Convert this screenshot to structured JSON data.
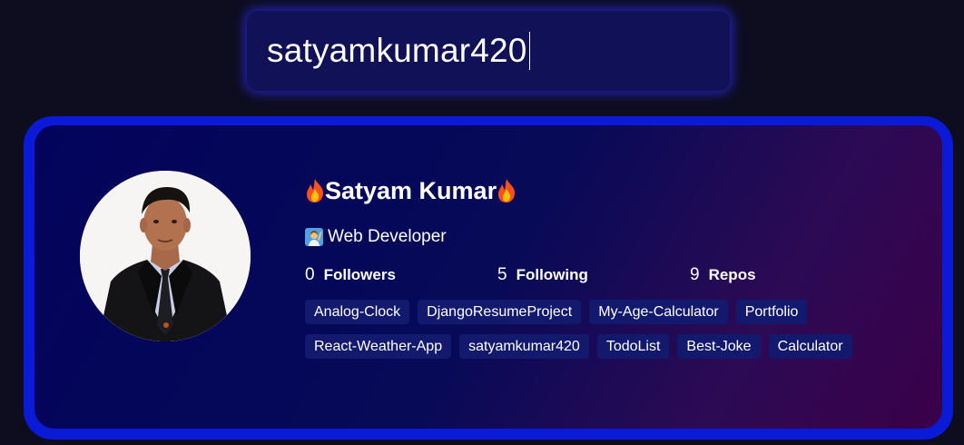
{
  "search": {
    "value": "satyamkumar420"
  },
  "profile": {
    "name": "Satyam Kumar",
    "name_prefix_icon": "fire-icon",
    "name_suffix_icon": "fire-icon",
    "bio": "Web Developer",
    "bio_icon": "person-raising-hand-icon",
    "avatar": "profile-photo"
  },
  "stats": [
    {
      "value": "0",
      "label": "Followers"
    },
    {
      "value": "5",
      "label": "Following"
    },
    {
      "value": "9",
      "label": "Repos"
    }
  ],
  "repos": [
    "Analog-Clock",
    "DjangoResumeProject",
    "My-Age-Calculator",
    "Portfolio",
    "React-Weather-App",
    "satyamkumar420",
    "TodoList",
    "Best-Joke",
    "Calculator"
  ],
  "colors": {
    "background": "#0e0d1f",
    "search_background": "#111158",
    "card_border": "#0a1ad6",
    "card_gradient_start": "#03035c",
    "card_gradient_end": "#3a0049",
    "repo_chip": "#131a6e"
  }
}
